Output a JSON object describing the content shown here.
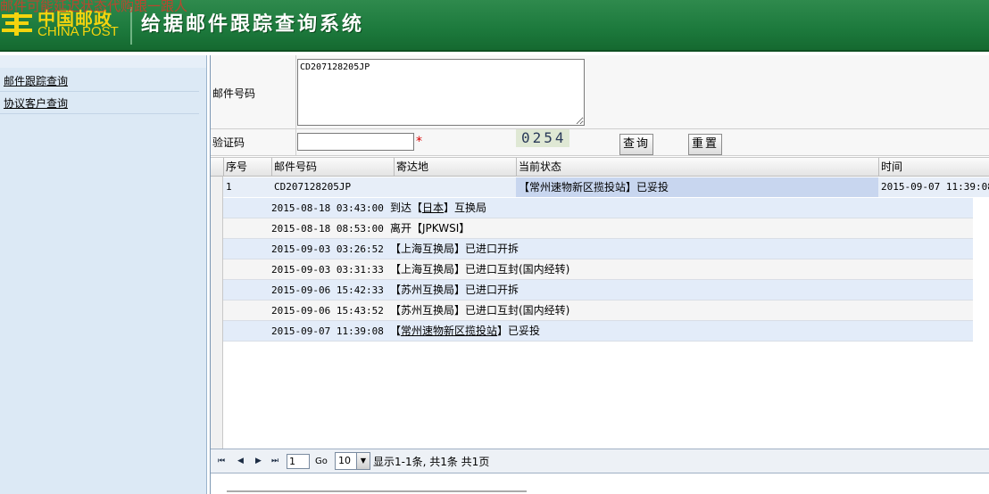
{
  "header": {
    "watermark": "邮件可能延迟状态代购跟一跟人",
    "logo_cn": "中国邮政",
    "logo_en": "CHINA POST",
    "title": "给据邮件跟踪查询系统",
    "brand_color": "#1d7a3d",
    "logo_color": "#f4d40e"
  },
  "sidebar": {
    "items": [
      {
        "label": "邮件跟踪查询"
      },
      {
        "label": "协议客户查询"
      }
    ]
  },
  "form": {
    "mail_label": "邮件号码",
    "mail_value": "CD207128205JP",
    "code_label": "验证码",
    "code_value": "",
    "required_mark": "*",
    "captcha_text": "0254",
    "query_button": "查询",
    "reset_button": "重置"
  },
  "grid": {
    "headers": [
      "序号",
      "邮件号码",
      "寄达地",
      "当前状态",
      "时间"
    ],
    "main_row": {
      "index": "1",
      "mail_no": "CD207128205JP",
      "destination": "",
      "status": "【常州速物新区揽投站】已妥投",
      "time": "2015-09-07 11:39:08"
    },
    "events": [
      {
        "time": "2015-08-18 03:43:00",
        "pre": "到达【",
        "link": "日本",
        "post": "】互换局"
      },
      {
        "time": "2015-08-18 08:53:00",
        "pre": "离开【JPKWSI】",
        "link": "",
        "post": ""
      },
      {
        "time": "2015-09-03 03:26:52",
        "pre": "【上海互换局】已进口开拆",
        "link": "",
        "post": ""
      },
      {
        "time": "2015-09-03 03:31:33",
        "pre": "【上海互换局】已进口互封(国内经转)",
        "link": "",
        "post": ""
      },
      {
        "time": "2015-09-06 15:42:33",
        "pre": "【苏州互换局】已进口开拆",
        "link": "",
        "post": ""
      },
      {
        "time": "2015-09-06 15:43:52",
        "pre": "【苏州互换局】已进口互封(国内经转)",
        "link": "",
        "post": ""
      },
      {
        "time": "2015-09-07 11:39:08",
        "pre": "【",
        "link": "常州速物新区揽投站",
        "post": "】已妥投"
      }
    ]
  },
  "pager": {
    "first_icon": "first-page-icon",
    "prev_icon": "prev-page-icon",
    "next_icon": "next-page-icon",
    "last_icon": "last-page-icon",
    "page_value": "1",
    "go_label": "Go",
    "page_size": "10",
    "info": "显示1-1条, 共1条   共1页"
  }
}
